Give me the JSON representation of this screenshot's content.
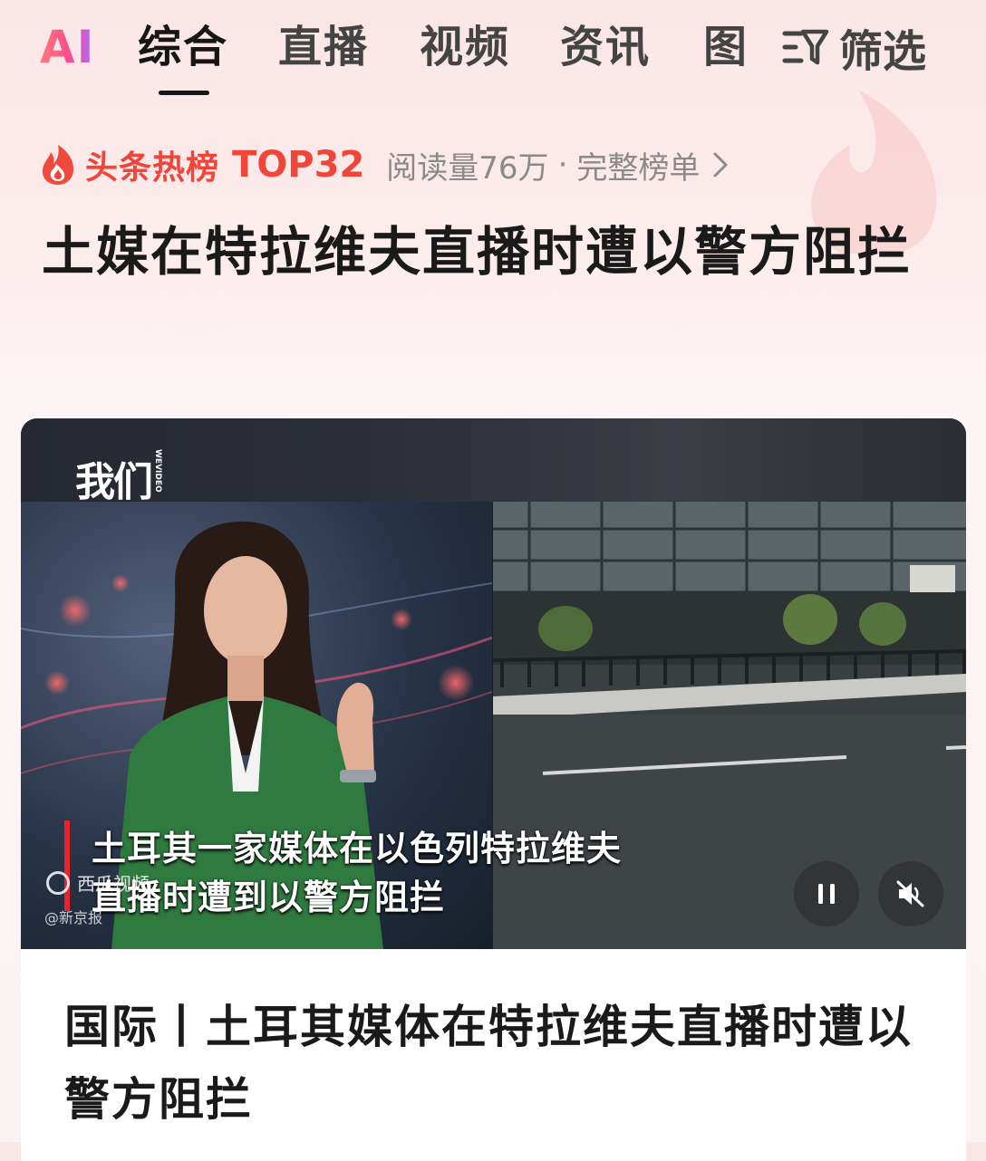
{
  "tabs": {
    "ai": "AI",
    "items": [
      "综合",
      "直播",
      "视频",
      "资讯",
      "图"
    ],
    "active_index": 0,
    "filter_label": "筛选"
  },
  "hot": {
    "label": "头条热榜",
    "rank": "TOP32",
    "reads": "阅读量76万",
    "separator": "·",
    "link": "完整榜单"
  },
  "headline": "土媒在特拉维夫直播时遭以警方阻拦",
  "video": {
    "logo": "我们",
    "logo_sub": "WEVIDEO",
    "subtitle_line1": "土耳其一家媒体在以色列特拉维夫",
    "subtitle_line2": "直播时遭到以警方阻拦",
    "watermark_xigua": "西瓜视频",
    "watermark_source": "@新京报",
    "playing": true,
    "muted": true
  },
  "card_title": "国际丨土耳其媒体在特拉维夫直播时遭以警方阻拦",
  "colors": {
    "accent_red": "#f0463a",
    "text_main": "#1a1a1a",
    "text_muted": "#8a8a8a"
  }
}
